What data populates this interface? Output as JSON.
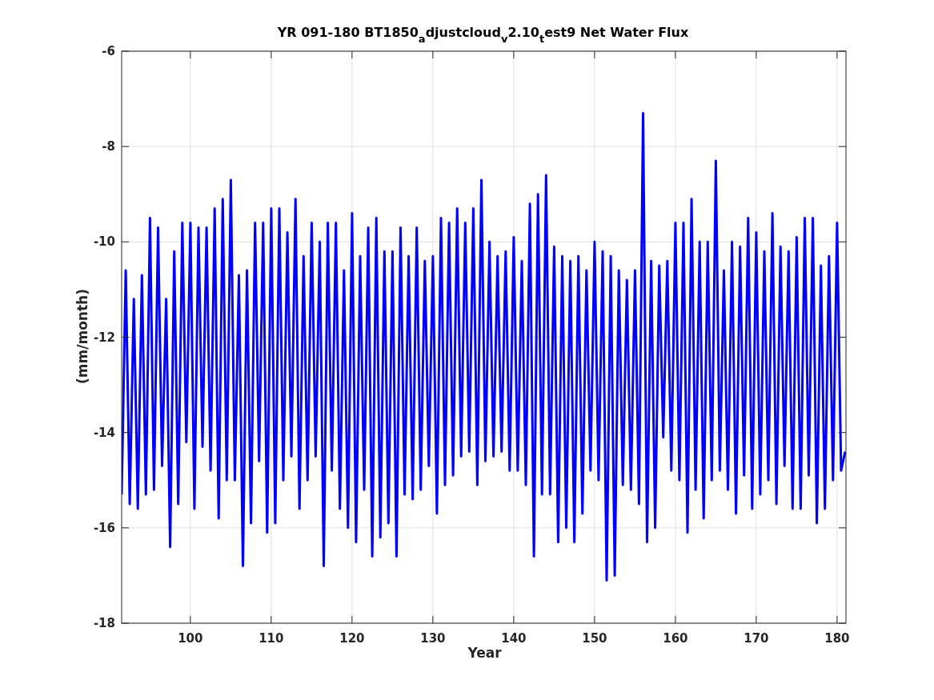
{
  "figure": {
    "chart_data": {
      "type": "line",
      "title": "YR 091-180 BT1850$_{a}$djustcloud$_{v}$2.10$_{t}$est9 Net Water Flux",
      "xlabel": "Year",
      "ylabel": "(mm/month)",
      "xlim": [
        91.5,
        181.1
      ],
      "ylim": [
        -18,
        -6
      ],
      "xticks": [
        100,
        110,
        120,
        130,
        140,
        150,
        160,
        170,
        180
      ],
      "yticks": [
        -18,
        -16,
        -14,
        -12,
        -10,
        -8,
        -6
      ],
      "grid": true,
      "x": [
        91.5,
        92,
        92.5,
        93,
        93.5,
        94,
        94.5,
        95,
        95.5,
        96,
        96.5,
        97,
        97.5,
        98,
        98.5,
        99,
        99.5,
        100,
        100.5,
        101,
        101.5,
        102,
        102.5,
        103,
        103.5,
        104,
        104.5,
        105,
        105.5,
        106,
        106.5,
        107,
        107.5,
        108,
        108.5,
        109,
        109.5,
        110,
        110.5,
        111,
        111.5,
        112,
        112.5,
        113,
        113.5,
        114,
        114.5,
        115,
        115.5,
        116,
        116.5,
        117,
        117.5,
        118,
        118.5,
        119,
        119.5,
        120,
        120.5,
        121,
        121.5,
        122,
        122.5,
        123,
        123.5,
        124,
        124.5,
        125,
        125.5,
        126,
        126.5,
        127,
        127.5,
        128,
        128.5,
        129,
        129.5,
        130,
        130.5,
        131,
        131.5,
        132,
        132.5,
        133,
        133.5,
        134,
        134.5,
        135,
        135.5,
        136,
        136.5,
        137,
        137.5,
        138,
        138.5,
        139,
        139.5,
        140,
        140.5,
        141,
        141.5,
        142,
        142.5,
        143,
        143.5,
        144,
        144.5,
        145,
        145.5,
        146,
        146.5,
        147,
        147.5,
        148,
        148.5,
        149,
        149.5,
        150,
        150.5,
        151,
        151.5,
        152,
        152.5,
        153,
        153.5,
        154,
        154.5,
        155,
        155.5,
        156,
        156.5,
        157,
        157.5,
        158,
        158.5,
        159,
        159.5,
        160,
        160.5,
        161,
        161.5,
        162,
        162.5,
        163,
        163.5,
        164,
        164.5,
        165,
        165.5,
        166,
        166.5,
        167,
        167.5,
        168,
        168.5,
        169,
        169.5,
        170,
        170.5,
        171,
        171.5,
        172,
        172.5,
        173,
        173.5,
        174,
        174.5,
        175,
        175.5,
        176,
        176.5,
        177,
        177.5,
        178,
        178.5,
        179,
        179.5,
        180,
        180.5,
        181
      ],
      "series": [
        {
          "color": "#0000ff",
          "values": [
            -15.3,
            -10.6,
            -15.5,
            -11.2,
            -15.6,
            -10.7,
            -15.3,
            -9.5,
            -15.2,
            -9.7,
            -14.7,
            -11.2,
            -16.4,
            -10.2,
            -15.5,
            -9.6,
            -14.2,
            -9.6,
            -15.6,
            -9.7,
            -14.3,
            -9.7,
            -14.8,
            -9.3,
            -15.8,
            -9.1,
            -15.0,
            -8.7,
            -15.0,
            -10.7,
            -16.8,
            -10.6,
            -15.9,
            -9.6,
            -14.6,
            -9.6,
            -16.1,
            -9.3,
            -15.9,
            -9.3,
            -15.0,
            -9.8,
            -14.5,
            -9.1,
            -15.6,
            -10.3,
            -15.0,
            -9.6,
            -14.5,
            -10.0,
            -16.8,
            -9.6,
            -14.8,
            -9.6,
            -15.6,
            -10.6,
            -16.0,
            -9.4,
            -16.3,
            -10.3,
            -15.2,
            -9.7,
            -16.6,
            -9.5,
            -16.2,
            -10.2,
            -15.9,
            -10.2,
            -16.6,
            -9.7,
            -15.3,
            -10.3,
            -15.4,
            -9.7,
            -15.2,
            -10.4,
            -14.7,
            -10.3,
            -15.7,
            -9.5,
            -15.1,
            -9.6,
            -14.9,
            -9.3,
            -14.5,
            -9.6,
            -14.4,
            -9.3,
            -15.1,
            -8.7,
            -14.6,
            -10.0,
            -14.5,
            -10.3,
            -14.4,
            -10.2,
            -14.8,
            -9.9,
            -14.8,
            -10.4,
            -15.1,
            -9.2,
            -16.6,
            -9.0,
            -15.3,
            -8.6,
            -15.3,
            -10.1,
            -16.3,
            -10.3,
            -16.0,
            -10.4,
            -16.3,
            -10.3,
            -15.7,
            -10.6,
            -14.8,
            -10.0,
            -15.0,
            -10.2,
            -17.1,
            -10.3,
            -17.0,
            -10.6,
            -15.1,
            -10.8,
            -15.2,
            -10.6,
            -15.5,
            -7.3,
            -16.3,
            -10.4,
            -16.0,
            -10.5,
            -14.1,
            -10.4,
            -14.8,
            -9.6,
            -15.0,
            -9.6,
            -16.1,
            -9.1,
            -15.2,
            -10.0,
            -15.8,
            -10.0,
            -15.0,
            -8.3,
            -14.8,
            -10.6,
            -15.2,
            -10.0,
            -15.7,
            -10.1,
            -14.9,
            -9.5,
            -15.6,
            -9.8,
            -15.3,
            -10.2,
            -15.0,
            -9.4,
            -15.5,
            -10.1,
            -14.7,
            -10.2,
            -15.6,
            -9.9,
            -15.6,
            -9.5,
            -14.9,
            -9.5,
            -15.9,
            -10.5,
            -15.6,
            -10.3,
            -15.0,
            -9.6,
            -14.8,
            -14.4
          ]
        }
      ]
    }
  }
}
